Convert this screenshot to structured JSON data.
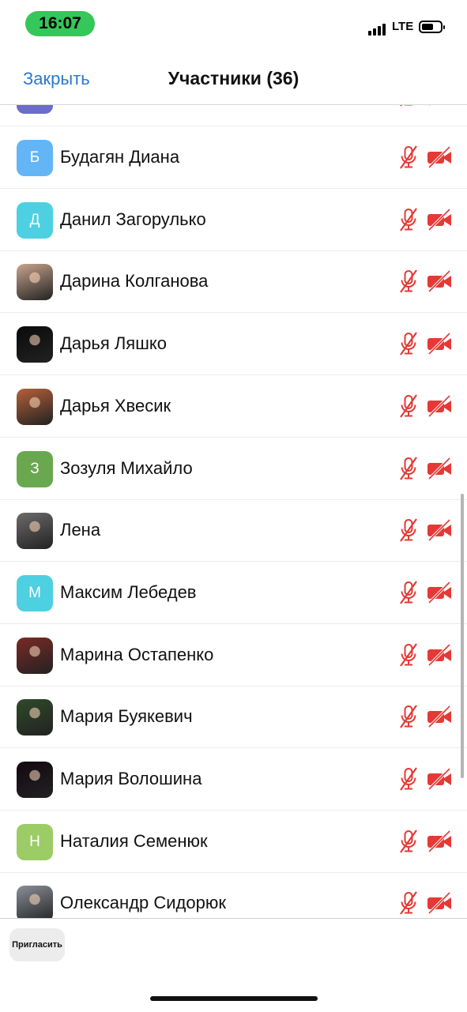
{
  "status_bar": {
    "time": "16:07",
    "network": "LTE"
  },
  "header": {
    "close_label": "Закрыть",
    "title": "Участники (36)"
  },
  "participants": [
    {
      "name": "Будагян Диана",
      "initial": "Б",
      "avatar_color": "#64b5f6",
      "avatar_type": "initial"
    },
    {
      "name": "Данил Загорулько",
      "initial": "Д",
      "avatar_color": "#4dd0e1",
      "avatar_type": "initial"
    },
    {
      "name": "Дарина Колганова",
      "initial": "",
      "avatar_color": "#c9a48e",
      "avatar_type": "photo"
    },
    {
      "name": "Дарья Ляшко",
      "initial": "",
      "avatar_color": "#0a0a0a",
      "avatar_type": "photo"
    },
    {
      "name": "Дарья Хвесик",
      "initial": "",
      "avatar_color": "#b5603a",
      "avatar_type": "photo"
    },
    {
      "name": "Зозуля Михайло",
      "initial": "З",
      "avatar_color": "#6aa84f",
      "avatar_type": "initial"
    },
    {
      "name": "Лена",
      "initial": "",
      "avatar_color": "#6d6a6a",
      "avatar_type": "photo"
    },
    {
      "name": "Максим Лебедев",
      "initial": "М",
      "avatar_color": "#4dd0e1",
      "avatar_type": "initial"
    },
    {
      "name": "Марина Остапенко",
      "initial": "",
      "avatar_color": "#7a2a25",
      "avatar_type": "photo"
    },
    {
      "name": "Мария Буякевич",
      "initial": "",
      "avatar_color": "#2f4a2a",
      "avatar_type": "photo"
    },
    {
      "name": "Мария Волошина",
      "initial": "",
      "avatar_color": "#120810",
      "avatar_type": "photo"
    },
    {
      "name": "Наталия Семенюк",
      "initial": "Н",
      "avatar_color": "#9ccc65",
      "avatar_type": "initial"
    },
    {
      "name": "Олександр Сидорюк",
      "initial": "",
      "avatar_color": "#8a8f98",
      "avatar_type": "photo"
    }
  ],
  "partial_row_avatar_color": "#6c6cc9",
  "icons": {
    "mic": "mic-muted-icon",
    "camera": "camera-off-icon"
  },
  "accent_color": "#2a78d4",
  "muted_color": "#e53935",
  "footer": {
    "invite_label": "Пригласить"
  }
}
